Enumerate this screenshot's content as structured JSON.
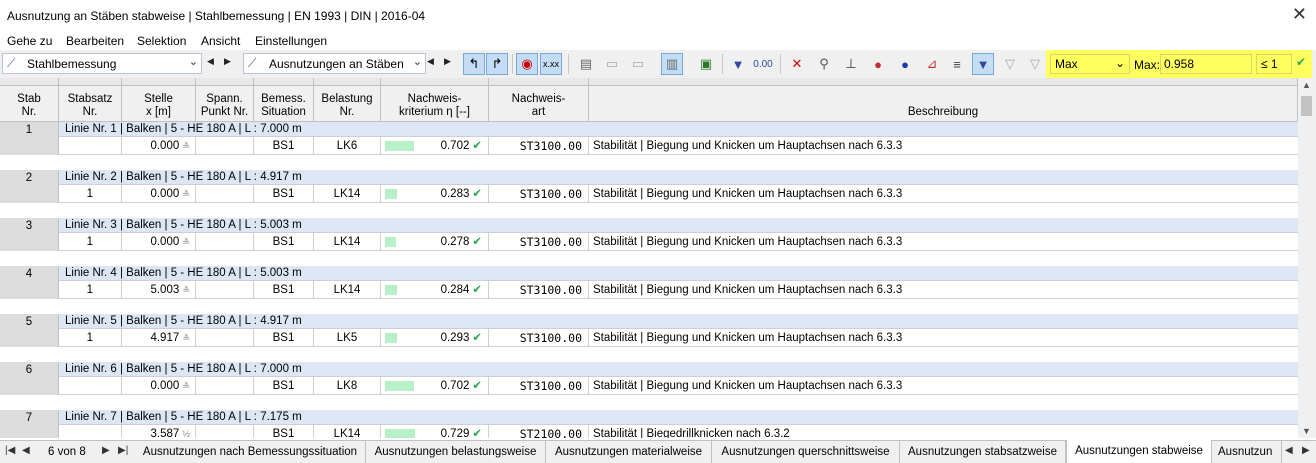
{
  "window": {
    "title": "Ausnutzung an Stäben stabweise | Stahlbemessung | EN 1993 | DIN | 2016-04",
    "close": "✕"
  },
  "menu": [
    "Gehe zu",
    "Bearbeiten",
    "Selektion",
    "Ansicht",
    "Einstellungen"
  ],
  "toolbar": {
    "module": "Stahlbemessung",
    "view": "Ausnutzungen an Stäben",
    "filter_select": "Max",
    "max_label": "Max:",
    "max_value": "0.958",
    "limit": "≤ 1"
  },
  "columns": {
    "stab": "Stab\nNr.",
    "stabsatz": "Stabsatz\nNr.",
    "stelle": "Stelle\nx [m]",
    "spann": "Spann.\nPunkt Nr.",
    "bemess": "Bemess.\nSituation",
    "belastung": "Belastung\nNr.",
    "krit": "Nachweis-\nkriterium η [--]",
    "art": "Nachweis-\nart",
    "beschreibung": "Beschreibung"
  },
  "rows": [
    {
      "stab": "1",
      "linie": "Linie Nr. 1 | Balken | 5 - HE 180 A | L : 7.000 m",
      "stabsatz": "",
      "x": "0.000",
      "xmark": "≚",
      "sit": "BS1",
      "lk": "LK6",
      "eta": "0.702",
      "eta_num": 0.702,
      "art": "ST3100.00",
      "desc": "Stabilität | Biegung und Knicken um Hauptachsen nach 6.3.3"
    },
    {
      "stab": "2",
      "linie": "Linie Nr. 2 | Balken | 5 - HE 180 A | L : 4.917 m",
      "stabsatz": "1",
      "x": "0.000",
      "xmark": "≚",
      "sit": "BS1",
      "lk": "LK14",
      "eta": "0.283",
      "eta_num": 0.283,
      "art": "ST3100.00",
      "desc": "Stabilität | Biegung und Knicken um Hauptachsen nach 6.3.3"
    },
    {
      "stab": "3",
      "linie": "Linie Nr. 3 | Balken | 5 - HE 180 A | L : 5.003 m",
      "stabsatz": "1",
      "x": "0.000",
      "xmark": "≚",
      "sit": "BS1",
      "lk": "LK14",
      "eta": "0.278",
      "eta_num": 0.278,
      "art": "ST3100.00",
      "desc": "Stabilität | Biegung und Knicken um Hauptachsen nach 6.3.3"
    },
    {
      "stab": "4",
      "linie": "Linie Nr. 4 | Balken | 5 - HE 180 A | L : 5.003 m",
      "stabsatz": "1",
      "x": "5.003",
      "xmark": "≚",
      "sit": "BS1",
      "lk": "LK14",
      "eta": "0.284",
      "eta_num": 0.284,
      "art": "ST3100.00",
      "desc": "Stabilität | Biegung und Knicken um Hauptachsen nach 6.3.3"
    },
    {
      "stab": "5",
      "linie": "Linie Nr. 5 | Balken | 5 - HE 180 A | L : 4.917 m",
      "stabsatz": "1",
      "x": "4.917",
      "xmark": "≚",
      "sit": "BS1",
      "lk": "LK5",
      "eta": "0.293",
      "eta_num": 0.293,
      "art": "ST3100.00",
      "desc": "Stabilität | Biegung und Knicken um Hauptachsen nach 6.3.3"
    },
    {
      "stab": "6",
      "linie": "Linie Nr. 6 | Balken | 5 - HE 180 A | L : 7.000 m",
      "stabsatz": "",
      "x": "0.000",
      "xmark": "≚",
      "sit": "BS1",
      "lk": "LK8",
      "eta": "0.702",
      "eta_num": 0.702,
      "art": "ST3100.00",
      "desc": "Stabilität | Biegung und Knicken um Hauptachsen nach 6.3.3"
    },
    {
      "stab": "7",
      "linie": "Linie Nr. 7 | Balken | 5 - HE 180 A | L : 7.175 m",
      "stabsatz": "",
      "x": "3.587",
      "xmark": "½",
      "sit": "BS1",
      "lk": "LK14",
      "eta": "0.729",
      "eta_num": 0.729,
      "art": "ST2100.00",
      "desc": "Stabilität | Biegedrillknicken nach 6.3.2"
    }
  ],
  "pager": "6 von 8",
  "tabs": [
    "Ausnutzungen nach Bemessungssituation",
    "Ausnutzungen belastungsweise",
    "Ausnutzungen materialweise",
    "Ausnutzungen querschnittsweise",
    "Ausnutzungen stabsatzweise",
    "Ausnutzungen stabweise",
    "Ausnutzun"
  ],
  "active_tab": 5,
  "colors": {
    "accent": "#ffff60",
    "row_header": "#dce6f4",
    "bar": "#b8f0c8",
    "check": "#2aa84a"
  }
}
